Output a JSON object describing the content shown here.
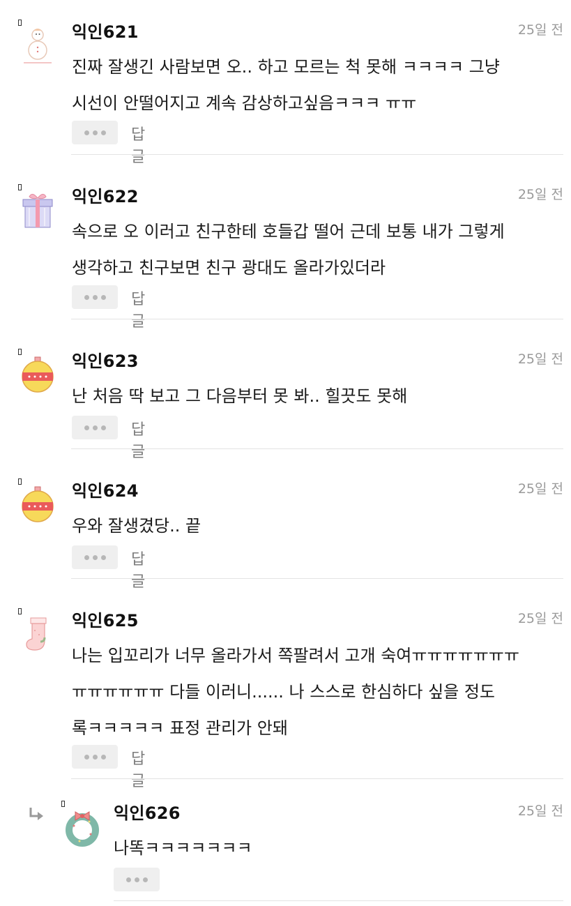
{
  "comments": [
    {
      "author": "익인621",
      "time": "25일 전",
      "text": "진짜 잘생긴 사람보면 오.. 하고 모르는 척 못해 ㅋㅋㅋㅋ 그냥\n시선이 안떨어지고 계속 감상하고싶음ㅋㅋㅋ ㅠㅠ",
      "reply_label": "답글",
      "avatar": "snowman-icon"
    },
    {
      "author": "익인622",
      "time": "25일 전",
      "text": "속으로 오 이러고 친구한테 호들갑 떨어 근데 보통 내가 그렇게\n생각하고 친구보면 친구 광대도 올라가있더라",
      "reply_label": "답글",
      "avatar": "gift-box-icon"
    },
    {
      "author": "익인623",
      "time": "25일 전",
      "text": "난 처음 딱 보고 그 다음부터 못 봐.. 힐끗도 못해",
      "reply_label": "답글",
      "avatar": "ornament-icon"
    },
    {
      "author": "익인624",
      "time": "25일 전",
      "text": "우와 잘생겼당.. 끝",
      "reply_label": "답글",
      "avatar": "ornament-icon"
    },
    {
      "author": "익인625",
      "time": "25일 전",
      "text": "나는 입꼬리가 너무 올라가서 쪽팔려서 고개 숙여ㅠㅠㅠㅠㅠㅠㅠ\nㅠㅠㅠㅠㅠㅠ 다들 이러니...... 나 스스로 한심하다 싶을 정도\n록ㅋㅋㅋㅋㅋ 표정 관리가 안돼",
      "reply_label": "답글",
      "avatar": "stocking-icon"
    }
  ],
  "reply_comment": {
    "author": "익인626",
    "time": "25일 전",
    "text": "나똑ㅋㅋㅋㅋㅋㅋㅋ",
    "avatar": "wreath-icon"
  },
  "colors": {
    "divider": "#e3e3e3",
    "time": "#9a9a9a",
    "more_button_bg": "#efefef"
  }
}
